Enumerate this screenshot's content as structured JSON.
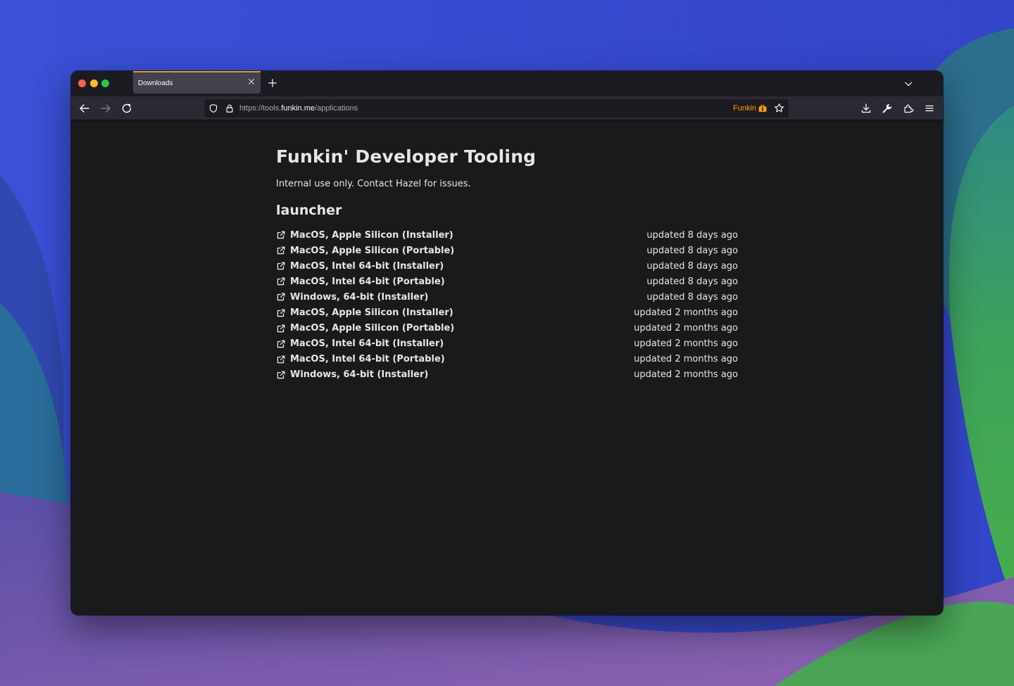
{
  "browser": {
    "tab": {
      "title": "Downloads"
    },
    "url": {
      "scheme": "https://tools.",
      "host": "funkin.me",
      "path": "/applications"
    },
    "extension_label": "Funkin"
  },
  "page": {
    "title": "Funkin' Developer Tooling",
    "subtitle": "Internal use only. Contact Hazel for issues.",
    "section_title": "launcher",
    "downloads": [
      {
        "label": "MacOS, Apple Silicon (Installer)",
        "updated": "updated 8 days ago"
      },
      {
        "label": "MacOS, Apple Silicon (Portable)",
        "updated": "updated 8 days ago"
      },
      {
        "label": "MacOS, Intel 64-bit (Installer)",
        "updated": "updated 8 days ago"
      },
      {
        "label": "MacOS, Intel 64-bit (Portable)",
        "updated": "updated 8 days ago"
      },
      {
        "label": "Windows, 64-bit (Installer)",
        "updated": "updated 8 days ago"
      },
      {
        "label": "MacOS, Apple Silicon (Installer)",
        "updated": "updated 2 months ago"
      },
      {
        "label": "MacOS, Apple Silicon (Portable)",
        "updated": "updated 2 months ago"
      },
      {
        "label": "MacOS, Intel 64-bit (Installer)",
        "updated": "updated 2 months ago"
      },
      {
        "label": "MacOS, Intel 64-bit (Portable)",
        "updated": "updated 2 months ago"
      },
      {
        "label": "Windows, 64-bit (Installer)",
        "updated": "updated 2 months ago"
      }
    ]
  },
  "icons": {
    "toolbar": [
      "back-arrow-icon",
      "forward-arrow-icon",
      "reload-icon",
      "shield-icon",
      "lock-icon",
      "briefcase-icon",
      "star-icon",
      "download-icon",
      "wrench-icon",
      "extensions-icon",
      "menu-icon"
    ],
    "link": "external-link-icon"
  },
  "colors": {
    "tab_accent": "#e8922a",
    "extension": "#ff9f0a",
    "page_background": "#181a1b",
    "text": "#e8e6e3"
  }
}
